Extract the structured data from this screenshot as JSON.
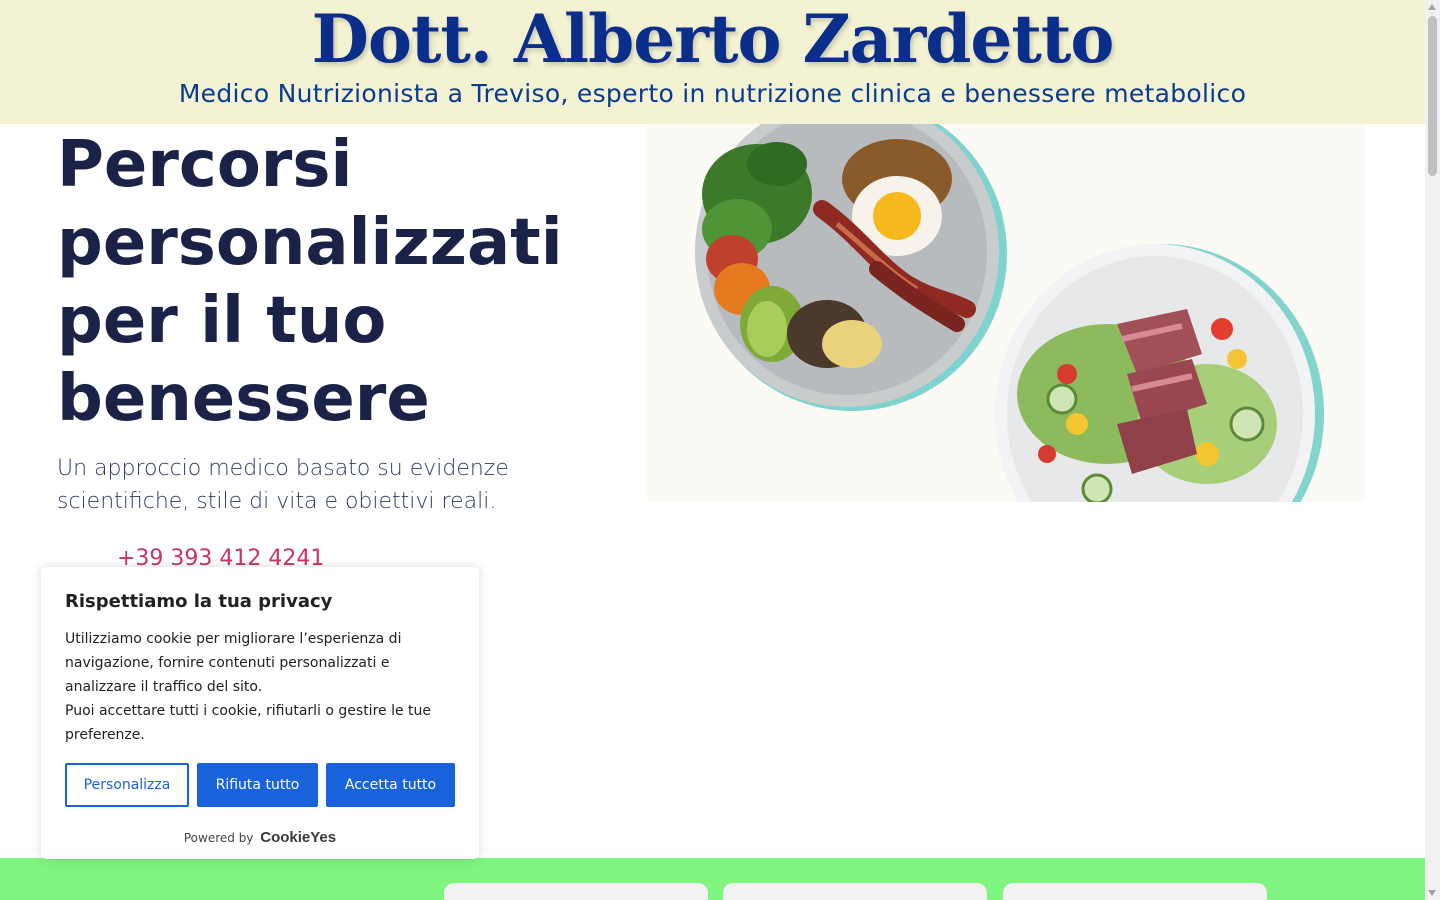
{
  "header": {
    "title": "Dott. Alberto Zardetto",
    "tagline": "Medico Nutrizionista a Treviso, esperto in nutrizione clinica e benessere metabolico"
  },
  "hero": {
    "heading_lines": [
      "Percorsi",
      "personalizzati",
      "per il tuo",
      "benessere"
    ],
    "subtitle": "Un approccio medico basato su evidenze scientifiche, stile di vita e obiettivi reali.",
    "phone": "+39 393 412 4241",
    "image_icon": "food-plates-image"
  },
  "cookie_banner": {
    "title": "Rispettiamo la tua privacy",
    "text_1": "Utilizziamo cookie per migliorare l’esperienza di navigazione, fornire contenuti personalizzati e analizzare il traffico del sito.",
    "text_2": "Puoi accettare tutti i cookie, rifiutarli o gestire le tue preferenze.",
    "customize_label": "Personalizza",
    "reject_label": "Rifiuta tutto",
    "accept_label": "Accetta tutto",
    "powered_by": "Powered by",
    "brand": "CookieYes"
  },
  "colors": {
    "header_bg": "#f3f2d3",
    "title": "#0b2e8a",
    "heading": "#1a2248",
    "phone": "#c8336a",
    "accent": "#1863dc",
    "band": "#7ef57e"
  }
}
